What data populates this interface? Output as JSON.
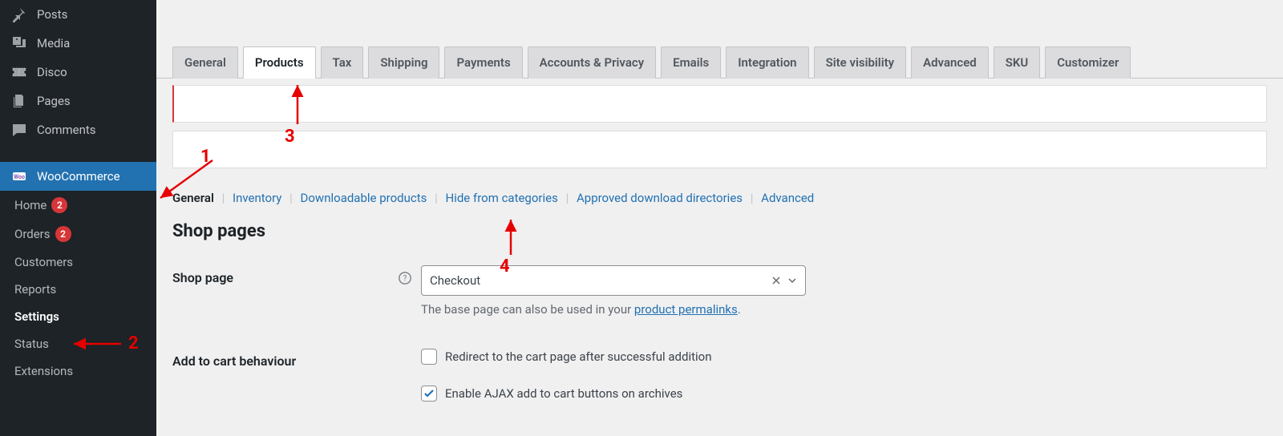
{
  "sidebar": {
    "items": [
      {
        "label": "Posts"
      },
      {
        "label": "Media"
      },
      {
        "label": "Disco"
      },
      {
        "label": "Pages"
      },
      {
        "label": "Comments"
      },
      {
        "label": "WooCommerce"
      }
    ],
    "submenu": {
      "home": {
        "label": "Home",
        "badge": "2"
      },
      "orders": {
        "label": "Orders",
        "badge": "2"
      },
      "customers": {
        "label": "Customers"
      },
      "reports": {
        "label": "Reports"
      },
      "settings": {
        "label": "Settings"
      },
      "status": {
        "label": "Status"
      },
      "extensions": {
        "label": "Extensions"
      }
    }
  },
  "tabs": [
    "General",
    "Products",
    "Tax",
    "Shipping",
    "Payments",
    "Accounts & Privacy",
    "Emails",
    "Integration",
    "Site visibility",
    "Advanced",
    "SKU",
    "Customizer"
  ],
  "subtabs": [
    "General",
    "Inventory",
    "Downloadable products",
    "Hide from categories",
    "Approved download directories",
    "Advanced"
  ],
  "section_title": "Shop pages",
  "form": {
    "shop_page": {
      "label": "Shop page",
      "value": "Checkout",
      "help_pre": "The base page can also be used in your ",
      "help_link": "product permalinks",
      "help_post": "."
    },
    "add_to_cart": {
      "label": "Add to cart behaviour",
      "opt1": "Redirect to the cart page after successful addition",
      "opt2": "Enable AJAX add to cart buttons on archives"
    }
  },
  "annotations": {
    "n1": "1",
    "n2": "2",
    "n3": "3",
    "n4": "4"
  }
}
